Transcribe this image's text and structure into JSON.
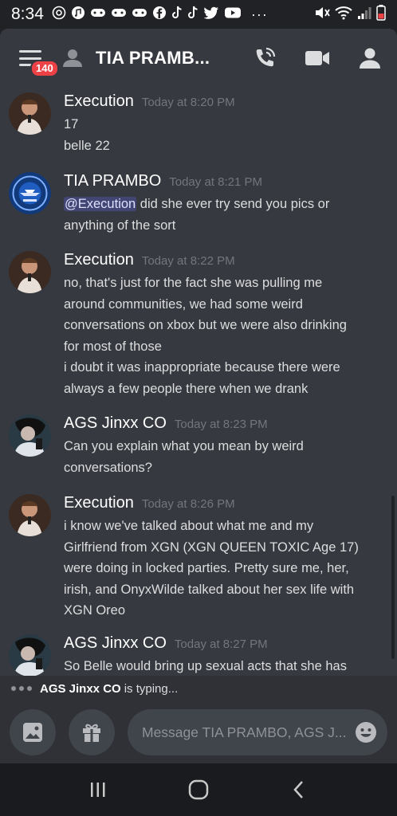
{
  "status_bar": {
    "time": "8:34",
    "icons": [
      "at-icon",
      "music-icon",
      "gamepad-icon",
      "gamepad-icon",
      "gamepad-icon",
      "facebook-icon",
      "tiktok-icon",
      "tiktok-icon",
      "twitter-icon",
      "youtube-icon",
      "more-icon"
    ],
    "right_icons": [
      "mute-icon",
      "wifi-icon",
      "signal-icon",
      "battery-icon"
    ]
  },
  "header": {
    "badge": "140",
    "title": "TIA PRAMB..."
  },
  "messages": [
    {
      "author": "Execution",
      "time": "Today at 8:20 PM",
      "lines": [
        "17",
        "belle 22"
      ]
    },
    {
      "author": "TIA PRAMBO",
      "time": "Today at 8:21 PM",
      "mention": "@Execution",
      "text_after_mention": " did she ever try send you pics or",
      "lines": [
        "anything of the sort"
      ]
    },
    {
      "author": "Execution",
      "time": "Today at 8:22 PM",
      "lines": [
        "no, that's just for the fact she was pulling me",
        "around communities, we had some weird",
        "conversations on xbox but we were also drinking",
        "for most of those",
        "i doubt it was inappropriate because there were",
        "always a few people there when we drank"
      ]
    },
    {
      "author": "AGS Jinxx CO",
      "time": "Today at 8:23 PM",
      "lines": [
        "Can you explain what you mean by weird",
        "conversations?"
      ]
    },
    {
      "author": "Execution",
      "time": "Today at 8:26 PM",
      "lines": [
        "i know we've talked about what me and my",
        "Girlfriend from XGN (XGN QUEEN TOXIC Age 17)",
        "were doing in locked parties. Pretty sure me, her,",
        "irish, and OnyxWilde talked about her sex life with",
        "XGN Oreo"
      ]
    },
    {
      "author": "AGS Jinxx CO",
      "time": "Today at 8:27 PM",
      "lines": [
        "So Belle would bring up sexual acts that she has"
      ]
    }
  ],
  "typing": {
    "user": "AGS Jinxx CO",
    "suffix": "is typing..."
  },
  "input": {
    "placeholder": "Message TIA PRAMBO, AGS J..."
  },
  "colors": {
    "background": "#36393f",
    "mention_bg": "#414675",
    "badge": "#ed4245"
  }
}
